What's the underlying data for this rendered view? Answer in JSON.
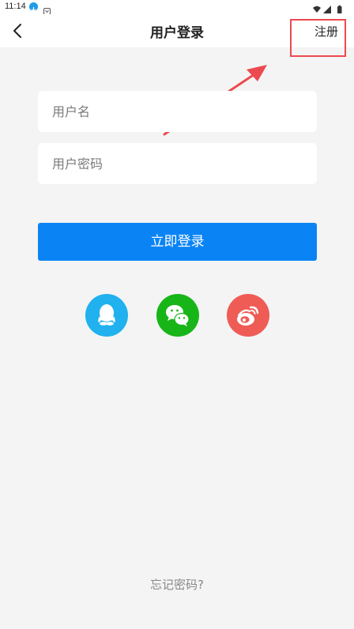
{
  "status_bar": {
    "time": "11:14",
    "icons": [
      "download-icon",
      "shield-icon",
      "wifi-icon",
      "signal-icon",
      "battery-icon"
    ]
  },
  "nav": {
    "title": "用户登录",
    "back_icon": "chevron-left-icon",
    "register_label": "注册"
  },
  "form": {
    "username_placeholder": "用户名",
    "password_placeholder": "用户密码",
    "login_label": "立即登录"
  },
  "social": [
    {
      "name": "qq",
      "icon": "qq-icon",
      "color": "#20b1ee"
    },
    {
      "name": "wechat",
      "icon": "wechat-icon",
      "color": "#18b519"
    },
    {
      "name": "weibo",
      "icon": "weibo-icon",
      "color": "#ef5b55"
    }
  ],
  "footer": {
    "forgot_label": "忘记密码?"
  },
  "colors": {
    "primary": "#0a84f5",
    "background": "#f4f4f4",
    "annotation": "#ec4a4f"
  }
}
